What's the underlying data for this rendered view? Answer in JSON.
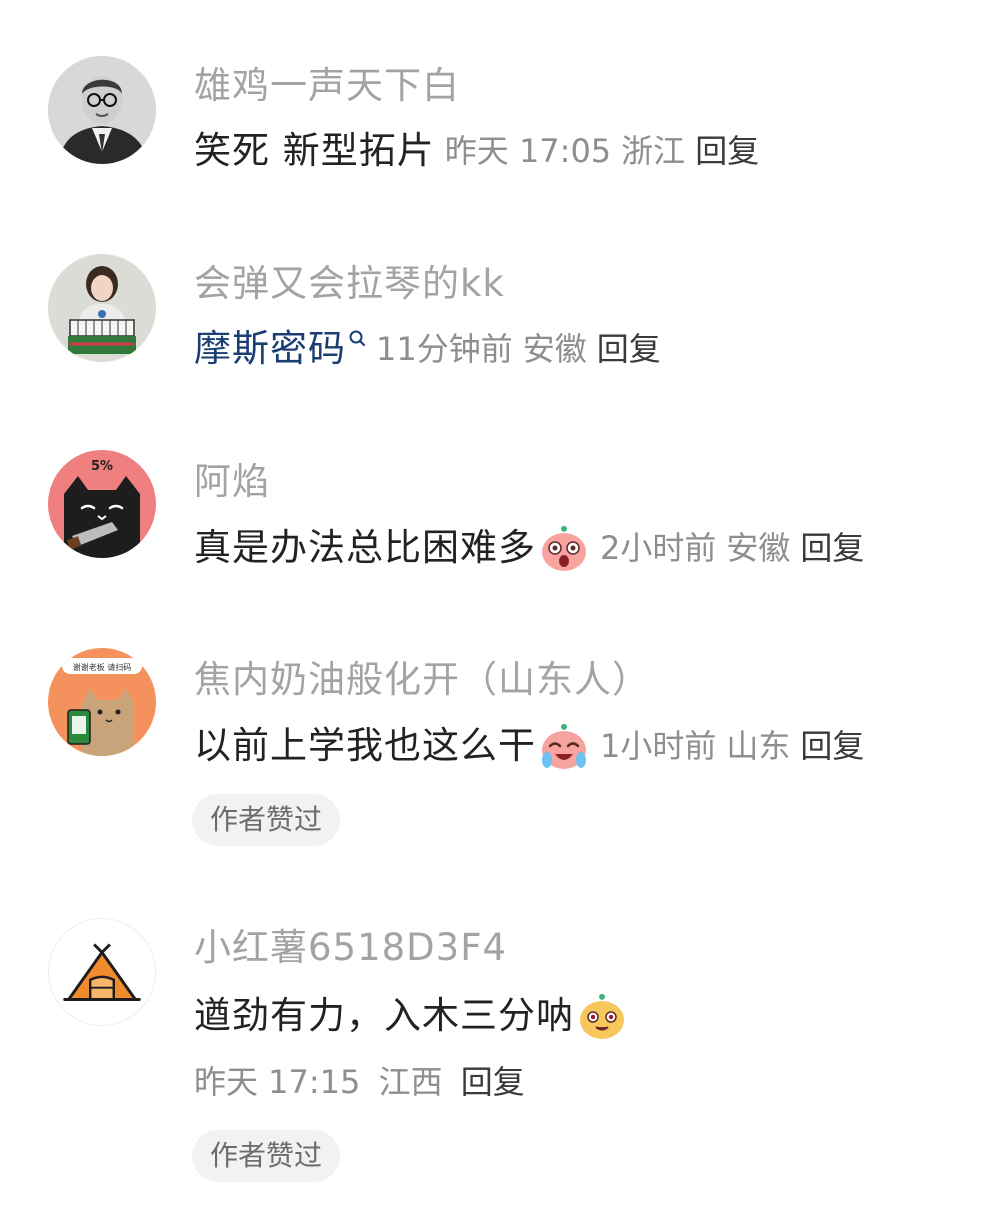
{
  "comments": [
    {
      "username": "雄鸡一声天下白",
      "text": "笑死 新型拓片",
      "time": "昨天 17:05",
      "location": "浙江",
      "reply": "回复",
      "avatar_icon": "bw-portrait-avatar"
    },
    {
      "username": "会弹又会拉琴的kk",
      "mention": "摩斯密码",
      "mention_icon": "search-icon",
      "time": "11分钟前",
      "location": "安徽",
      "reply": "回复",
      "avatar_icon": "girl-with-keyboard-avatar"
    },
    {
      "username": "阿焰",
      "text": "真是办法总比困难多",
      "emoji": "shocked-face-emoji",
      "time": "2小时前",
      "location": "安徽",
      "reply": "回复",
      "avatar_icon": "black-cat-avatar",
      "avatar_text": "5%"
    },
    {
      "username": "焦内奶油般化开（山东人）",
      "text": "以前上学我也这么干",
      "emoji": "crying-laughing-emoji",
      "time": "1小时前",
      "location": "山东",
      "reply": "回复",
      "badge": "作者赞过",
      "avatar_icon": "cat-with-phone-avatar",
      "avatar_text": "谢谢老板 请扫码"
    },
    {
      "username": "小红薯6518D3F4",
      "text": "遒劲有力，入木三分呐",
      "emoji": "smug-face-emoji",
      "time": "昨天 17:15",
      "location": "江西",
      "reply": "回复",
      "badge": "作者赞过",
      "avatar_icon": "orange-tent-avatar"
    }
  ],
  "colors": {
    "username": "#a3a3a3",
    "text": "#222222",
    "meta": "#8e8e8e",
    "mention": "#1a3e72",
    "badge_bg": "#f2f2f2"
  }
}
